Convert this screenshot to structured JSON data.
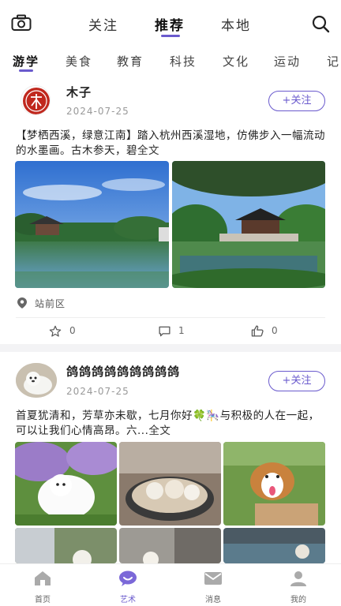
{
  "header": {
    "tabs": [
      {
        "label": "关注"
      },
      {
        "label": "推荐"
      },
      {
        "label": "本地"
      }
    ],
    "active_tab": "推荐"
  },
  "categories": [
    "游学",
    "美食",
    "教育",
    "科技",
    "文化",
    "运动",
    "记"
  ],
  "posts": [
    {
      "author": "木子",
      "date": "2024-07-25",
      "follow_label": "+关注",
      "text": "【梦栖西溪，绿意江南】踏入杭州西溪湿地，仿佛步入一幅流动的水墨画。古木参天，碧",
      "more_label": "全文",
      "location": "站前区",
      "likes_star": "0",
      "comments": "1",
      "thumbs": "0"
    },
    {
      "author": "鸽鸽鸽鸽鸽鸽鸽鸽鸽",
      "date": "2024-07-25",
      "follow_label": "+关注",
      "text": "首夏犹清和，芳草亦未歇，七月你好🍀🎠与积极的人在一起，可以让我们心情高昂。六...",
      "more_label": "全文"
    }
  ],
  "bottom_nav": [
    {
      "label": "首页",
      "icon": "home-icon"
    },
    {
      "label": "艺术",
      "icon": "chat-bubble-icon"
    },
    {
      "label": "消息",
      "icon": "mail-icon"
    },
    {
      "label": "我的",
      "icon": "user-icon"
    }
  ],
  "colors": {
    "accent": "#6a5acd"
  }
}
